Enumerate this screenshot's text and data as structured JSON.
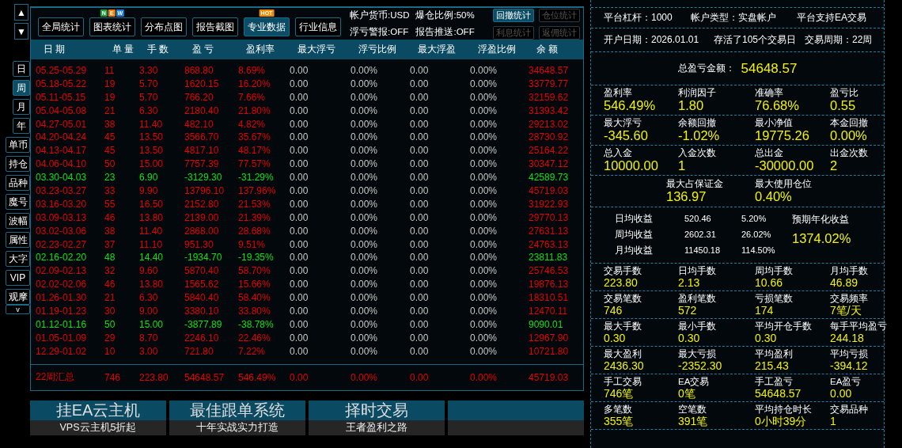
{
  "scroll_buttons": [
    "▲",
    "▼"
  ],
  "side_buttons": [
    {
      "label": "日",
      "selected": false,
      "kind": "period"
    },
    {
      "label": "周",
      "selected": true,
      "kind": "period"
    },
    {
      "label": "月",
      "selected": false,
      "kind": "period"
    },
    {
      "label": "年",
      "selected": false,
      "kind": "period"
    },
    {
      "label": "单币",
      "selected": false,
      "kind": "view"
    },
    {
      "label": "持仓",
      "selected": false,
      "kind": "view"
    },
    {
      "label": "品种",
      "selected": false,
      "kind": "view"
    },
    {
      "label": "魔号",
      "selected": false,
      "kind": "view"
    },
    {
      "label": "波幅",
      "selected": false,
      "kind": "view"
    },
    {
      "label": "属性",
      "selected": false,
      "kind": "view"
    },
    {
      "label": "大字",
      "selected": false,
      "kind": "view"
    },
    {
      "label": "VIP",
      "selected": false,
      "kind": "view"
    },
    {
      "label": "观摩",
      "selected": false,
      "kind": "view"
    },
    {
      "label": "v",
      "selected": false,
      "kind": "more"
    }
  ],
  "toolbar": {
    "buttons": [
      {
        "label": "全局统计",
        "selected": false
      },
      {
        "label": "图表统计",
        "selected": false,
        "badge": [
          {
            "text": "N",
            "color": "#1e9e3c"
          },
          {
            "text": "E",
            "color": "#f07c00"
          },
          {
            "text": "W",
            "color": "#1a7fe0"
          }
        ]
      },
      {
        "label": "分布点图",
        "selected": false
      },
      {
        "label": "报告截图",
        "selected": false
      },
      {
        "label": "专业数据",
        "selected": true,
        "badge": [
          {
            "text": "HOT",
            "color": "#f08a00"
          }
        ]
      },
      {
        "label": "行业信息",
        "selected": false
      }
    ],
    "info": [
      "帐户货币:USD",
      "爆仓比例:50%",
      "浮亏警报:OFF",
      "报告推送:OFF"
    ],
    "stat_buttons": [
      {
        "label": "回撤统计",
        "disabled": false
      },
      {
        "label": "仓位统计",
        "disabled": true
      },
      {
        "label": "利息统计",
        "disabled": true
      },
      {
        "label": "返佣统计",
        "disabled": true
      }
    ]
  },
  "table": {
    "columns": [
      "日 期",
      "单 量",
      "手 数",
      "盈 亏",
      "盈利率",
      "最大浮亏",
      "浮亏比例",
      "最大浮盈",
      "浮盈比例",
      "余 额"
    ],
    "rows": [
      {
        "color": "#e60000",
        "cells": [
          "05.25-05.29",
          "11",
          "3.30",
          "868.80",
          "8.69%",
          "0.00",
          "0.00%",
          "0.00",
          "0.00%",
          "34648.57"
        ]
      },
      {
        "color": "#e60000",
        "cells": [
          "05.18-05.22",
          "19",
          "5.70",
          "1620.15",
          "16.20%",
          "0.00",
          "0.00%",
          "0.00",
          "0.00%",
          "33779.77"
        ]
      },
      {
        "color": "#e60000",
        "cells": [
          "05.11-05.15",
          "19",
          "5.70",
          "766.20",
          "7.66%",
          "0.00",
          "0.00%",
          "0.00",
          "0.00%",
          "32159.62"
        ]
      },
      {
        "color": "#e60000",
        "cells": [
          "05.04-05.08",
          "21",
          "6.30",
          "2180.40",
          "21.80%",
          "0.00",
          "0.00%",
          "0.00",
          "0.00%",
          "31393.42"
        ]
      },
      {
        "color": "#e60000",
        "cells": [
          "04.27-05.01",
          "38",
          "11.40",
          "482.10",
          "4.82%",
          "0.00",
          "0.00%",
          "0.00",
          "0.00%",
          "29213.02"
        ]
      },
      {
        "color": "#e60000",
        "cells": [
          "04.20-04.24",
          "45",
          "13.50",
          "3566.70",
          "35.67%",
          "0.00",
          "0.00%",
          "0.00",
          "0.00%",
          "28730.92"
        ]
      },
      {
        "color": "#e60000",
        "cells": [
          "04.13-04.17",
          "45",
          "13.50",
          "4817.10",
          "48.17%",
          "0.00",
          "0.00%",
          "0.00",
          "0.00%",
          "25164.22"
        ]
      },
      {
        "color": "#e60000",
        "cells": [
          "04.06-04.10",
          "50",
          "15.00",
          "7757.39",
          "77.57%",
          "0.00",
          "0.00%",
          "0.00",
          "0.00%",
          "30347.12"
        ]
      },
      {
        "color": "#10e010",
        "cells": [
          "03.30-04.03",
          "23",
          "6.90",
          "-3129.30",
          "-31.29%",
          "0.00",
          "0.00%",
          "0.00",
          "0.00%",
          "42589.73"
        ]
      },
      {
        "color": "#e60000",
        "cells": [
          "03.23-03.27",
          "33",
          "9.90",
          "13796.10",
          "137.96%",
          "0.00",
          "0.00%",
          "0.00",
          "0.00%",
          "45719.03"
        ]
      },
      {
        "color": "#e60000",
        "cells": [
          "03.16-03.20",
          "55",
          "16.50",
          "2152.80",
          "21.53%",
          "0.00",
          "0.00%",
          "0.00",
          "0.00%",
          "31922.93"
        ]
      },
      {
        "color": "#e60000",
        "cells": [
          "03.09-03.13",
          "46",
          "13.80",
          "2139.00",
          "21.39%",
          "0.00",
          "0.00%",
          "0.00",
          "0.00%",
          "29770.13"
        ]
      },
      {
        "color": "#e60000",
        "cells": [
          "03.02-03.06",
          "38",
          "11.40",
          "2868.00",
          "28.68%",
          "0.00",
          "0.00%",
          "0.00",
          "0.00%",
          "27631.13"
        ]
      },
      {
        "color": "#e60000",
        "cells": [
          "02.23-02.27",
          "37",
          "11.10",
          "951.30",
          "9.51%",
          "0.00",
          "0.00%",
          "0.00",
          "0.00%",
          "24763.13"
        ]
      },
      {
        "color": "#10e010",
        "cells": [
          "02.16-02.20",
          "48",
          "14.40",
          "-1934.70",
          "-19.35%",
          "0.00",
          "0.00%",
          "0.00",
          "0.00%",
          "23811.83"
        ]
      },
      {
        "color": "#e60000",
        "cells": [
          "02.09-02.13",
          "32",
          "9.60",
          "5870.40",
          "58.70%",
          "0.00",
          "0.00%",
          "0.00",
          "0.00%",
          "25746.53"
        ]
      },
      {
        "color": "#e60000",
        "cells": [
          "02.02-02.06",
          "46",
          "13.80",
          "1565.62",
          "15.66%",
          "0.00",
          "0.00%",
          "0.00",
          "0.00%",
          "19876.13"
        ]
      },
      {
        "color": "#e60000",
        "cells": [
          "01.26-01.30",
          "21",
          "6.30",
          "5840.40",
          "58.40%",
          "0.00",
          "0.00%",
          "0.00",
          "0.00%",
          "18310.51"
        ]
      },
      {
        "color": "#e60000",
        "cells": [
          "01.19-01.23",
          "30",
          "9.00",
          "3380.10",
          "33.80%",
          "0.00",
          "0.00%",
          "0.00",
          "0.00%",
          "12470.11"
        ]
      },
      {
        "color": "#10e010",
        "cells": [
          "01.12-01.16",
          "50",
          "15.00",
          "-3877.89",
          "-38.78%",
          "0.00",
          "0.00%",
          "0.00",
          "0.00%",
          "9090.01"
        ]
      },
      {
        "color": "#e60000",
        "cells": [
          "01.05-01.09",
          "29",
          "8.70",
          "2246.10",
          "22.46%",
          "0.00",
          "0.00%",
          "0.00",
          "0.00%",
          "12967.90"
        ]
      },
      {
        "color": "#e60000",
        "cells": [
          "12.29-01.02",
          "10",
          "3.00",
          "721.80",
          "7.22%",
          "0.00",
          "0.00%",
          "0.00",
          "0.00%",
          "10721.80"
        ]
      }
    ],
    "summary": {
      "color": "#e60000",
      "cells": [
        "22周汇总",
        "746",
        "223.80",
        "54648.57",
        "546.49%",
        "0.00",
        "0.00%",
        "0.00",
        "0.00%",
        "45719.03"
      ]
    }
  },
  "ads": [
    {
      "kind": "banner",
      "title": "挂EA云主机",
      "subtitle": "VPS云主机5折起"
    },
    {
      "kind": "banner",
      "title": "最佳跟单系统",
      "subtitle": "十年实战实力打造"
    },
    {
      "kind": "banner",
      "title": "择时交易",
      "subtitle": "王者盈利之路"
    },
    {
      "kind": "blank"
    }
  ],
  "info_rows": [
    [
      "平台杠杆：1000",
      "帐户类型：实盘帐户",
      "平台支持EA交易"
    ],
    [
      "开户日期：2026.01.01",
      "存活了105个交易日",
      "交易周期：22周"
    ]
  ],
  "total": {
    "label": "总盈亏金额：",
    "value": "54648.57"
  },
  "stat_groups": [
    [
      {
        "label": "盈利率",
        "value": "546.49%"
      },
      {
        "label": "利润因子",
        "value": "1.80"
      },
      {
        "label": "准确率",
        "value": "76.68%"
      },
      {
        "label": "盈亏比",
        "value": "0.55"
      }
    ],
    [
      {
        "label": "最大浮亏",
        "value": "-345.60"
      },
      {
        "label": "余额回撤",
        "value": "-1.02%"
      },
      {
        "label": "最小净值",
        "value": "19775.26"
      },
      {
        "label": "本金回撤",
        "value": "0.00%"
      }
    ],
    [
      {
        "label": "总入金",
        "value": "10000.00"
      },
      {
        "label": "入金次数",
        "value": "1"
      },
      {
        "label": "总出金",
        "value": "-30000.00"
      },
      {
        "label": "出金次数",
        "value": "2"
      }
    ]
  ],
  "margin": [
    {
      "label": "最大占保证金",
      "value": "136.97"
    },
    {
      "label": "最大使用仓位",
      "value": "0.40%"
    }
  ],
  "returns": {
    "rows": [
      {
        "label": "日均收益",
        "amount": "520.46",
        "percent": "5.20%"
      },
      {
        "label": "周均收益",
        "amount": "2602.31",
        "percent": "26.02%"
      },
      {
        "label": "月均收益",
        "amount": "11450.18",
        "percent": "114.50%"
      }
    ],
    "annual": {
      "label": "预期年化收益",
      "value": "1374.02%"
    }
  },
  "detail_groups": [
    [
      {
        "label": "交易手数",
        "value": "223.80"
      },
      {
        "label": "日均手数",
        "value": "2.13"
      },
      {
        "label": "周均手数",
        "value": "10.66"
      },
      {
        "label": "月均手数",
        "value": "46.89"
      }
    ],
    [
      {
        "label": "交易笔数",
        "value": "746"
      },
      {
        "label": "盈利笔数",
        "value": "572"
      },
      {
        "label": "亏损笔数",
        "value": "174"
      },
      {
        "label": "交易频率",
        "value": "7笔/天"
      }
    ],
    [
      {
        "label": "最大手数",
        "value": "0.30"
      },
      {
        "label": "最小手数",
        "value": "0.30"
      },
      {
        "label": "平均开仓手数",
        "value": "0.30"
      },
      {
        "label": "每手平均盈亏",
        "value": "244.18"
      }
    ],
    [
      {
        "label": "最大盈利",
        "value": "2436.30"
      },
      {
        "label": "最大亏损",
        "value": "-2352.30"
      },
      {
        "label": "平均盈利",
        "value": "215.43"
      },
      {
        "label": "平均亏损",
        "value": "-394.12"
      }
    ],
    [
      {
        "label": "手工交易",
        "value": "746笔"
      },
      {
        "label": "EA交易",
        "value": "0笔"
      },
      {
        "label": "手工盈亏",
        "value": "54648.57"
      },
      {
        "label": "EA盈亏",
        "value": "0.00"
      }
    ],
    [
      {
        "label": "多笔数",
        "value": "355笔"
      },
      {
        "label": "空笔数",
        "value": "391笔"
      },
      {
        "label": "平均持仓时长",
        "value": "0小时39分"
      },
      {
        "label": "交易品种",
        "value": "1"
      }
    ]
  ]
}
